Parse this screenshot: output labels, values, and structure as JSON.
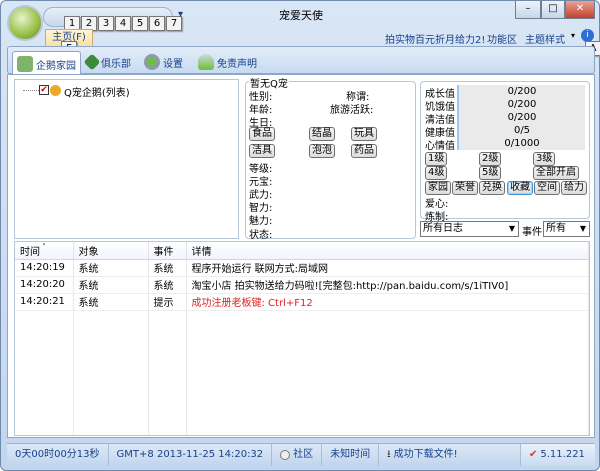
{
  "window": {
    "title": "宠爱天使",
    "minimize": "–",
    "maximize": "□",
    "close": "✕"
  },
  "qat": {
    "keytips": [
      "1",
      "2",
      "3",
      "4",
      "5",
      "6",
      "7"
    ],
    "more": "▾"
  },
  "ribbon": {
    "home_tab": "主页(F)",
    "home_keytip": "F",
    "links": [
      "拍实物百元折月给力2!",
      "功能区",
      "主题样式"
    ],
    "theme_arrow": "▾",
    "help_keytip": "A",
    "tabs": [
      {
        "label": "企鹅家园"
      },
      {
        "label": "俱乐部"
      },
      {
        "label": "设置"
      },
      {
        "label": "免责声明"
      }
    ]
  },
  "tree": {
    "root": "Q宠企鹅(列表)"
  },
  "info": {
    "title": "暂无Q宠",
    "gender": "性别:",
    "nickname": "称谓:",
    "age": "年龄:",
    "travel": "旅游活跃:",
    "birthday": "生日:",
    "item_buttons": [
      "食品",
      "结晶",
      "玩具",
      "洁具",
      "泡泡",
      "药品"
    ],
    "fields": [
      "等级:",
      "元宝:",
      "武力:",
      "智力:",
      "魅力:",
      "状态:"
    ]
  },
  "stats": {
    "rows": [
      {
        "label": "成长值",
        "value": "0/200"
      },
      {
        "label": "饥饿值",
        "value": "0/200"
      },
      {
        "label": "清洁值",
        "value": "0/200"
      },
      {
        "label": "健康值",
        "value": "0/5"
      },
      {
        "label": "心情值",
        "value": "0/1000"
      }
    ],
    "level_buttons": [
      "1级",
      "2级",
      "3级",
      "4级",
      "5级",
      "全部开启"
    ],
    "action_buttons": [
      "家园",
      "荣誉",
      "兑换",
      "收藏",
      "空间",
      "给力"
    ],
    "love": "爱心:",
    "refine": "炼制:"
  },
  "filters": {
    "log_select": "所有日志",
    "event_label": "事件",
    "event_select": "所有"
  },
  "log": {
    "columns": [
      "时间",
      "对象",
      "事件",
      "详情"
    ],
    "rows": [
      {
        "time": "14:20:19",
        "object": "系统",
        "event": "系统",
        "detail": "程序开始运行 联网方式:局域网",
        "color": "#000000"
      },
      {
        "time": "14:20:20",
        "object": "系统",
        "event": "系统",
        "detail": "淘宝小店 拍实物送给力码啦![完整包:http://pan.baidu.com/s/1iTIV0]",
        "color": "#000000"
      },
      {
        "time": "14:20:21",
        "object": "系统",
        "event": "提示",
        "detail": "成功注册老板键: Ctrl+F12",
        "color": "#e02020"
      }
    ]
  },
  "status": {
    "uptime": "0天00时00分13秒",
    "datetime": "GMT+8 2013-11-25 14:20:32",
    "community": "社区",
    "unknown_time": "未知时间",
    "download": "成功下载文件!",
    "version": "5.11.221"
  }
}
